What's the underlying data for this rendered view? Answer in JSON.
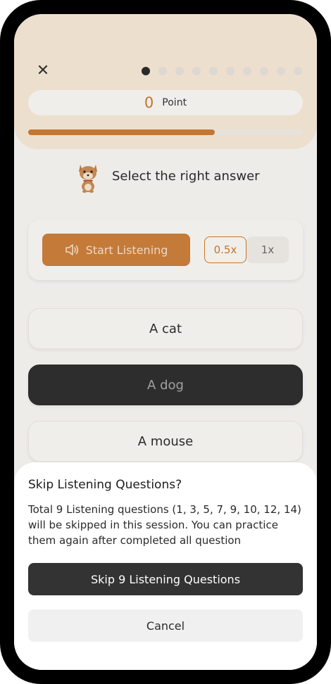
{
  "quiz": {
    "close_icon": "close-icon",
    "progress_dots": {
      "total": 10,
      "current": 1
    },
    "points": {
      "value": "0",
      "label": "Point"
    },
    "progress_fraction": 0.68,
    "prompt": "Select the right answer",
    "mascot_icon": "shiba-dog-mascot-icon"
  },
  "player": {
    "listen_label": "Start Listening",
    "speaker_icon": "speaker-icon",
    "speeds": [
      "0.5x",
      "1x"
    ],
    "selected_speed": "0.5x"
  },
  "options": [
    {
      "label": "A cat",
      "selected": false
    },
    {
      "label": "A dog",
      "selected": true
    },
    {
      "label": "A mouse",
      "selected": false
    }
  ],
  "dialog": {
    "title": "Skip Listening Questions?",
    "body": "Total 9 Listening questions (1, 3, 5, 7, 9, 10, 12, 14) will be skipped in this session. You can practice them again after completed all question",
    "confirm_label": "Skip 9 Listening Questions",
    "cancel_label": "Cancel"
  },
  "colors": {
    "accent": "#c87a34",
    "header_bg": "#f2e4d3",
    "selected_option": "#2e2e2e"
  }
}
